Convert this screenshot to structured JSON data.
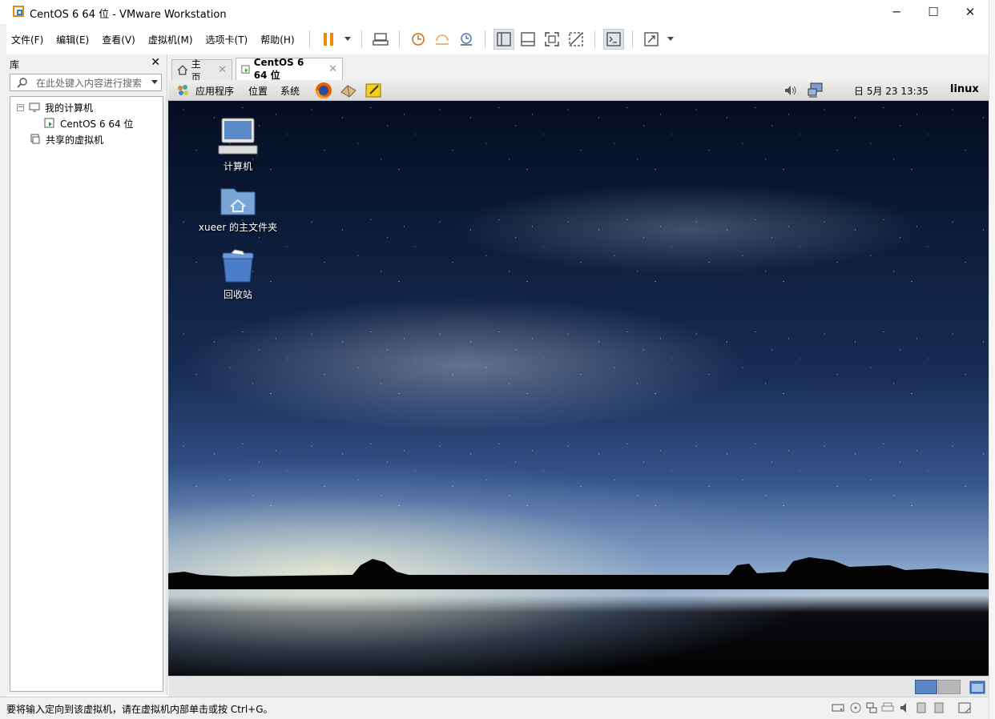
{
  "window": {
    "title": "CentOS 6 64 位 - VMware Workstation",
    "minimize": "─",
    "maximize": "☐",
    "close": "✕"
  },
  "menu": [
    "文件(F)",
    "编辑(E)",
    "查看(V)",
    "虚拟机(M)",
    "选项卡(T)",
    "帮助(H)"
  ],
  "library": {
    "header": "库",
    "close": "✕",
    "search_placeholder": "在此处键入内容进行搜索",
    "tree": {
      "my_computer": "我的计算机",
      "vm": "CentOS 6 64 位",
      "shared": "共享的虚拟机",
      "expander": "−"
    }
  },
  "tabs": [
    {
      "label": "主页",
      "close": "✕"
    },
    {
      "label": "CentOS 6 64 位",
      "close": "✕"
    }
  ],
  "guest_panel": {
    "applications": "应用程序",
    "places": "位置",
    "system": "系统",
    "datetime": "日  5月 23 13:35",
    "user": "linux"
  },
  "desktop_icons": [
    {
      "label": "计算机",
      "icon": "computer-icon"
    },
    {
      "label": "xueer 的主文件夹",
      "icon": "home-folder-icon"
    },
    {
      "label": "回收站",
      "icon": "trash-icon"
    }
  ],
  "status": {
    "message": "要将输入定向到该虚拟机，请在虚拟机内部单击或按 Ctrl+G。"
  },
  "colors": {
    "accent": "#e38b10",
    "pause": "#f08a00",
    "workspace_active": "#5a85c4"
  }
}
